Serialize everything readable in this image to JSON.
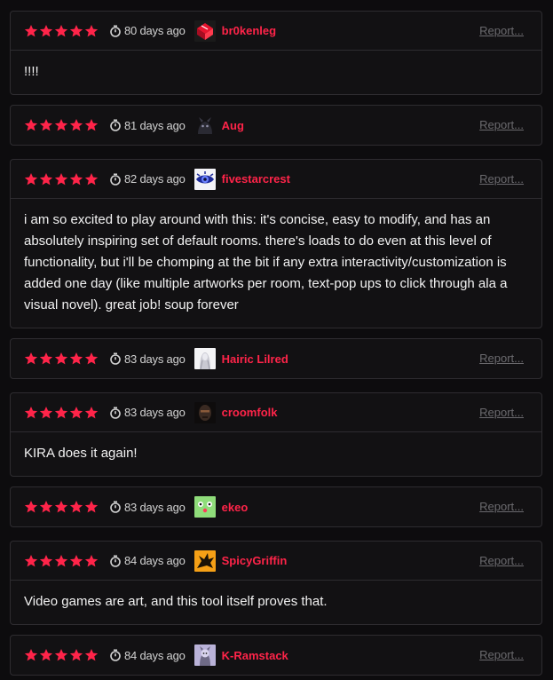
{
  "colors": {
    "star": "#ff2449",
    "username": "#ff2449",
    "background": "#0d0c0e"
  },
  "reviews": [
    {
      "rating": 5,
      "time": "80 days ago",
      "username": "br0kenleg",
      "avatar_icon": "red-cube-avatar-icon",
      "report": "Report...",
      "body": "!!!!"
    },
    {
      "rating": 5,
      "time": "81 days ago",
      "username": "Aug",
      "avatar_icon": "dark-creature-avatar-icon",
      "report": "Report...",
      "body": ""
    },
    {
      "rating": 5,
      "time": "82 days ago",
      "username": "fivestarcrest",
      "avatar_icon": "blue-eye-avatar-icon",
      "report": "Report...",
      "body": "i am so excited to play around with this: it's concise, easy to modify, and has an absolutely inspiring set of default rooms. there's loads to do even at this level of functionality, but i'll be chomping at the bit if any extra interactivity/customization is added one day (like multiple artworks per room, text-pop ups to click through ala a visual novel). great job! soup forever"
    },
    {
      "rating": 5,
      "time": "83 days ago",
      "username": "Hairic Lilred",
      "avatar_icon": "white-haired-figure-avatar-icon",
      "report": "Report...",
      "body": ""
    },
    {
      "rating": 5,
      "time": "83 days ago",
      "username": "croomfolk",
      "avatar_icon": "dark-face-avatar-icon",
      "report": "Report...",
      "body": "KIRA  does it again!"
    },
    {
      "rating": 5,
      "time": "83 days ago",
      "username": "ekeo",
      "avatar_icon": "green-frog-avatar-icon",
      "report": "Report...",
      "body": ""
    },
    {
      "rating": 5,
      "time": "84 days ago",
      "username": "SpicyGriffin",
      "avatar_icon": "orange-griffin-avatar-icon",
      "report": "Report...",
      "body": "Video games are art, and this tool itself proves that."
    },
    {
      "rating": 5,
      "time": "84 days ago",
      "username": "K-Ramstack",
      "avatar_icon": "lavender-creature-avatar-icon",
      "report": "Report...",
      "body": ""
    }
  ]
}
